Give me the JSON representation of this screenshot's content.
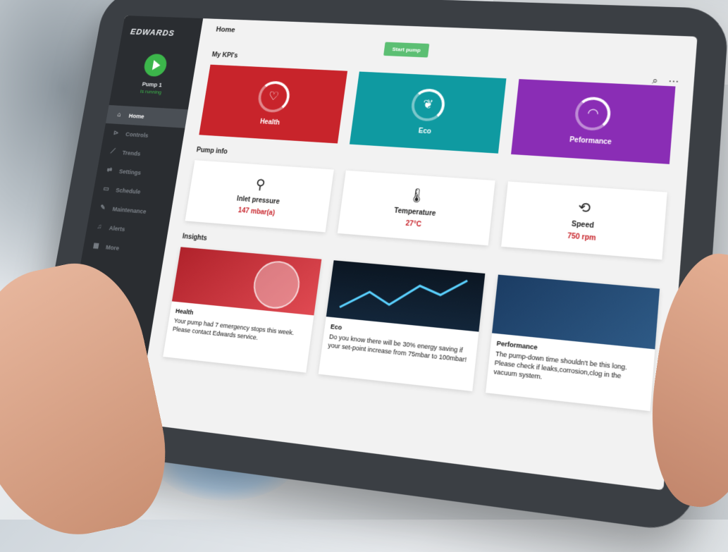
{
  "app": {
    "logo": "EDWARDS",
    "page_title": "Home",
    "start_button": "Start pump"
  },
  "pump": {
    "name": "Pump 1",
    "status": "Is running"
  },
  "sidebar": {
    "items": [
      {
        "label": "Home",
        "icon": "home-icon",
        "active": true
      },
      {
        "label": "Controls",
        "icon": "controls-icon"
      },
      {
        "label": "Trends",
        "icon": "trends-icon"
      },
      {
        "label": "Settings",
        "icon": "settings-icon"
      },
      {
        "label": "Schedule",
        "icon": "calendar-icon"
      },
      {
        "label": "Maintenance",
        "icon": "wrench-icon"
      },
      {
        "label": "Alerts",
        "icon": "bell-icon"
      },
      {
        "label": "More",
        "icon": "grid-icon"
      }
    ],
    "bottom_icons": [
      "cloud-icon",
      "clock-icon",
      "sync-icon"
    ]
  },
  "kpis": {
    "title": "My KPI's",
    "items": [
      {
        "label": "Health",
        "color": "#c8242b",
        "icon": "heart-icon"
      },
      {
        "label": "Eco",
        "color": "#0f9aa1",
        "icon": "leaf-icon"
      },
      {
        "label": "Peformance",
        "color": "#8a2db5",
        "icon": "gauge-icon"
      }
    ]
  },
  "pump_info": {
    "title": "Pump info",
    "items": [
      {
        "label": "Inlet pressure",
        "value": "147 mbar(a)",
        "icon": "pressure-gauge-icon"
      },
      {
        "label": "Temperature",
        "value": "27°C",
        "icon": "thermometer-icon"
      },
      {
        "label": "Speed",
        "value": "750 rpm",
        "icon": "rotate-icon"
      }
    ]
  },
  "insights": {
    "title": "Insights",
    "items": [
      {
        "title": "Health",
        "text": "Your pump had 7 emergency stops this week. Please contact Edwards service."
      },
      {
        "title": "Eco",
        "text": "Do you know there will be 30% energy saving if your set-point increase from 75mbar to 100mbar!"
      },
      {
        "title": "Performance",
        "text": "The pump-down time shouldn't be this long. Please check if leaks,corrosion,clog in the vacuum system."
      }
    ]
  }
}
